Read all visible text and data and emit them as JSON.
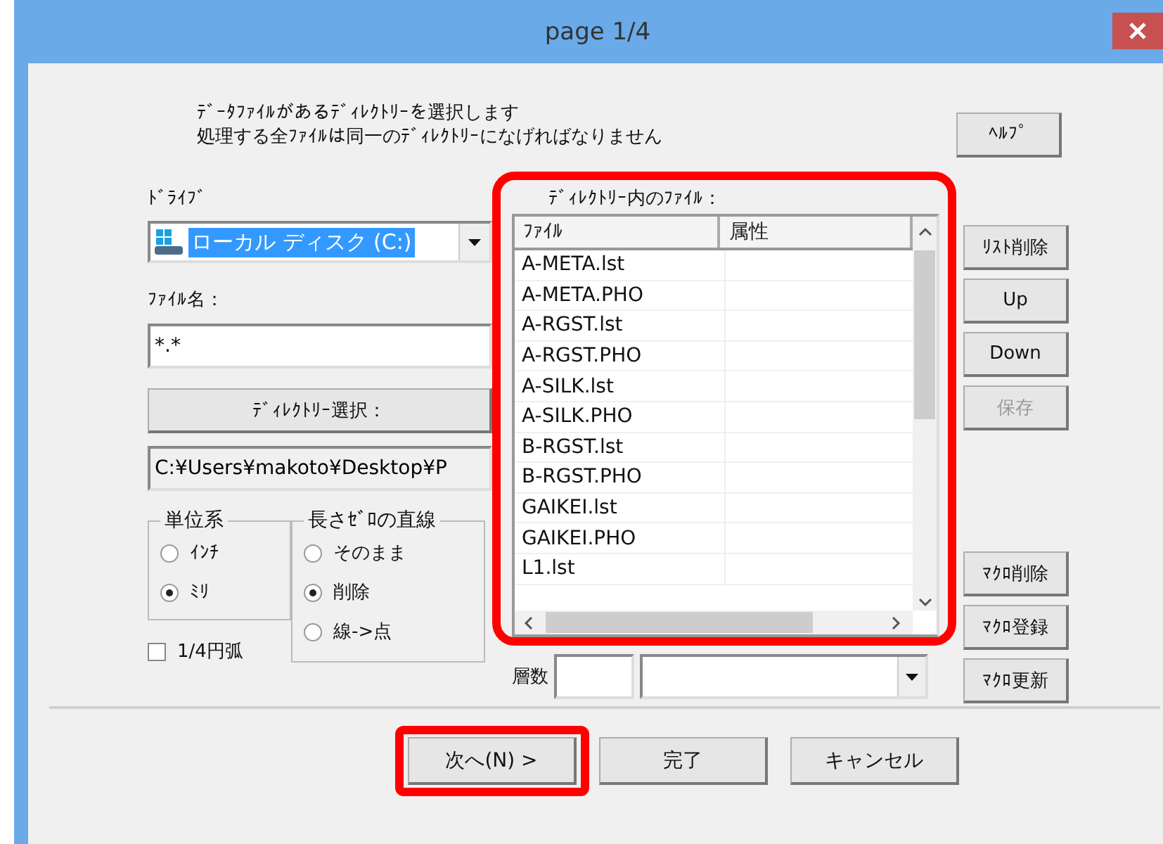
{
  "window": {
    "title": "page 1/4"
  },
  "instructions": [
    "ﾃﾞｰﾀﾌｧｲﾙがあるﾃﾞｨﾚｸﾄﾘｰを選択します",
    "処理する全ﾌｧｲﾙは同一のﾃﾞｨﾚｸﾄﾘｰになげればなりません"
  ],
  "help_button": "ﾍﾙﾌﾟ",
  "drive": {
    "label": "ﾄﾞﾗｲﾌﾞ",
    "value": "ローカル ディスク (C:)"
  },
  "file_name": {
    "label": "ﾌｧｲﾙ名：",
    "value": "*.*"
  },
  "directory_button": "ﾃﾞｨﾚｸﾄﾘｰ選択：",
  "directory_path": "C:¥Users¥makoto¥Desktop¥P",
  "unit_group": {
    "title": "単位系",
    "options": [
      {
        "label": "ｲﾝﾁ",
        "selected": false
      },
      {
        "label": "ﾐﾘ",
        "selected": true
      }
    ]
  },
  "zero_length_group": {
    "title": "長さｾﾞﾛの直線",
    "options": [
      {
        "label": "そのまま",
        "selected": false
      },
      {
        "label": "削除",
        "selected": true
      },
      {
        "label": "線->点",
        "selected": false
      }
    ]
  },
  "quarter_arc": {
    "label": "1/4円弧",
    "checked": false
  },
  "file_panel": {
    "label": "ﾃﾞｨﾚｸﾄﾘｰ内のﾌｧｲﾙ：",
    "highlighted": true,
    "columns": [
      "ﾌｧｲﾙ",
      "属性"
    ],
    "rows": [
      "A-META.lst",
      "A-META.PHO",
      "A-RGST.lst",
      "A-RGST.PHO",
      "A-SILK.lst",
      "A-SILK.PHO",
      "B-RGST.lst",
      "B-RGST.PHO",
      "GAIKEI.lst",
      "GAIKEI.PHO",
      "L1.lst"
    ]
  },
  "layers": {
    "label": "層数"
  },
  "side_buttons": [
    {
      "label": "ﾘｽﾄ削除",
      "disabled": false
    },
    {
      "label": "Up",
      "disabled": false
    },
    {
      "label": "Down",
      "disabled": false
    },
    {
      "label": "保存",
      "disabled": true
    }
  ],
  "macro_buttons": [
    {
      "label": "ﾏｸﾛ削除",
      "disabled": false
    },
    {
      "label": "ﾏｸﾛ登録",
      "disabled": false
    },
    {
      "label": "ﾏｸﾛ更新",
      "disabled": false
    }
  ],
  "footer_buttons": [
    {
      "label": "次へ(N) >",
      "highlighted": true
    },
    {
      "label": "完了",
      "highlighted": false
    },
    {
      "label": "キャンセル",
      "highlighted": false
    }
  ]
}
